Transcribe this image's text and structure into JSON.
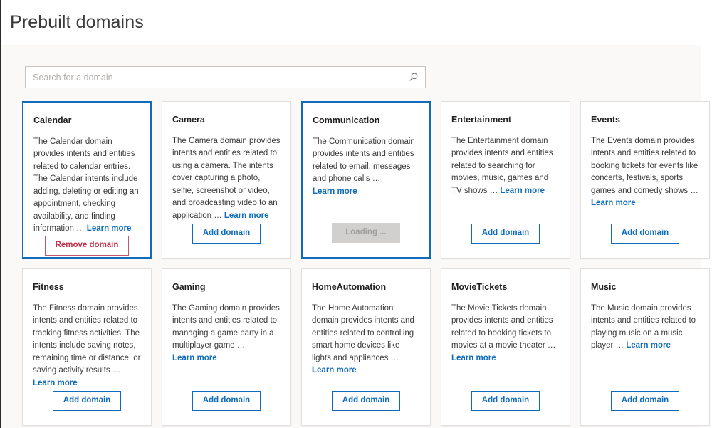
{
  "header": {
    "title": "Prebuilt domains"
  },
  "search": {
    "placeholder": "Search for a domain",
    "value": "",
    "icon": "search-icon"
  },
  "labels": {
    "learn_more": "Learn more",
    "ellipsis": "… "
  },
  "colors": {
    "accent": "#0f6cbd",
    "remove": "#c4314b",
    "selected_border": "#0f6cbd",
    "card_border": "#e1dfdd",
    "content_bg": "#faf9f8",
    "disabled_bg": "#d2d0ce",
    "disabled_text": "#a19f9d"
  },
  "cards": [
    {
      "title": "Calendar",
      "description": "The Calendar domain provides intents and entities related to calendar entries. The Calendar intents include adding, deleting or editing an appointment, checking availability, and finding information ",
      "learn_more": "Learn more",
      "button_label": "Remove domain",
      "button_state": "remove",
      "selected": true
    },
    {
      "title": "Camera",
      "description": "The Camera domain provides intents and entities related to using a camera. The intents cover capturing a photo, selfie, screenshot or video, and broadcasting video to an application ",
      "learn_more": "Learn more",
      "button_label": "Add domain",
      "button_state": "add",
      "selected": false
    },
    {
      "title": "Communication",
      "description": "The Communication domain provides intents and entities related to email, messages and phone calls ",
      "learn_more": "Learn more",
      "button_label": "Loading ...",
      "button_state": "loading",
      "selected": true
    },
    {
      "title": "Entertainment",
      "description": "The Entertainment domain provides intents and entities related to searching for movies, music, games and TV shows ",
      "learn_more": "Learn more",
      "button_label": "Add domain",
      "button_state": "add",
      "selected": false
    },
    {
      "title": "Events",
      "description": "The Events domain provides intents and entities related to booking tickets for events like concerts, festivals, sports games and comedy shows ",
      "learn_more": "Learn more",
      "button_label": "Add domain",
      "button_state": "add",
      "selected": false
    },
    {
      "title": "Fitness",
      "description": "The Fitness domain provides intents and entities related to tracking fitness activities. The intents include saving notes, remaining time or distance, or saving activity results ",
      "learn_more": "Learn more",
      "button_label": "Add domain",
      "button_state": "add",
      "selected": false
    },
    {
      "title": "Gaming",
      "description": "The Gaming domain provides intents and entities related to managing a game party in a multiplayer game ",
      "learn_more": "Learn more",
      "button_label": "Add domain",
      "button_state": "add",
      "selected": false
    },
    {
      "title": "HomeAutomation",
      "description": "The Home Automation domain provides intents and entities related to controlling smart home devices like lights and appliances ",
      "learn_more": "Learn more",
      "button_label": "Add domain",
      "button_state": "add",
      "selected": false
    },
    {
      "title": "MovieTickets",
      "description": "The Movie Tickets domain provides intents and entities related to booking tickets to movies at a movie theater ",
      "learn_more": "Learn more",
      "button_label": "Add domain",
      "button_state": "add",
      "selected": false
    },
    {
      "title": "Music",
      "description": "The Music domain provides intents and entities related to playing music on a music player ",
      "learn_more": "Learn more",
      "button_label": "Add domain",
      "button_state": "add",
      "selected": false
    }
  ]
}
